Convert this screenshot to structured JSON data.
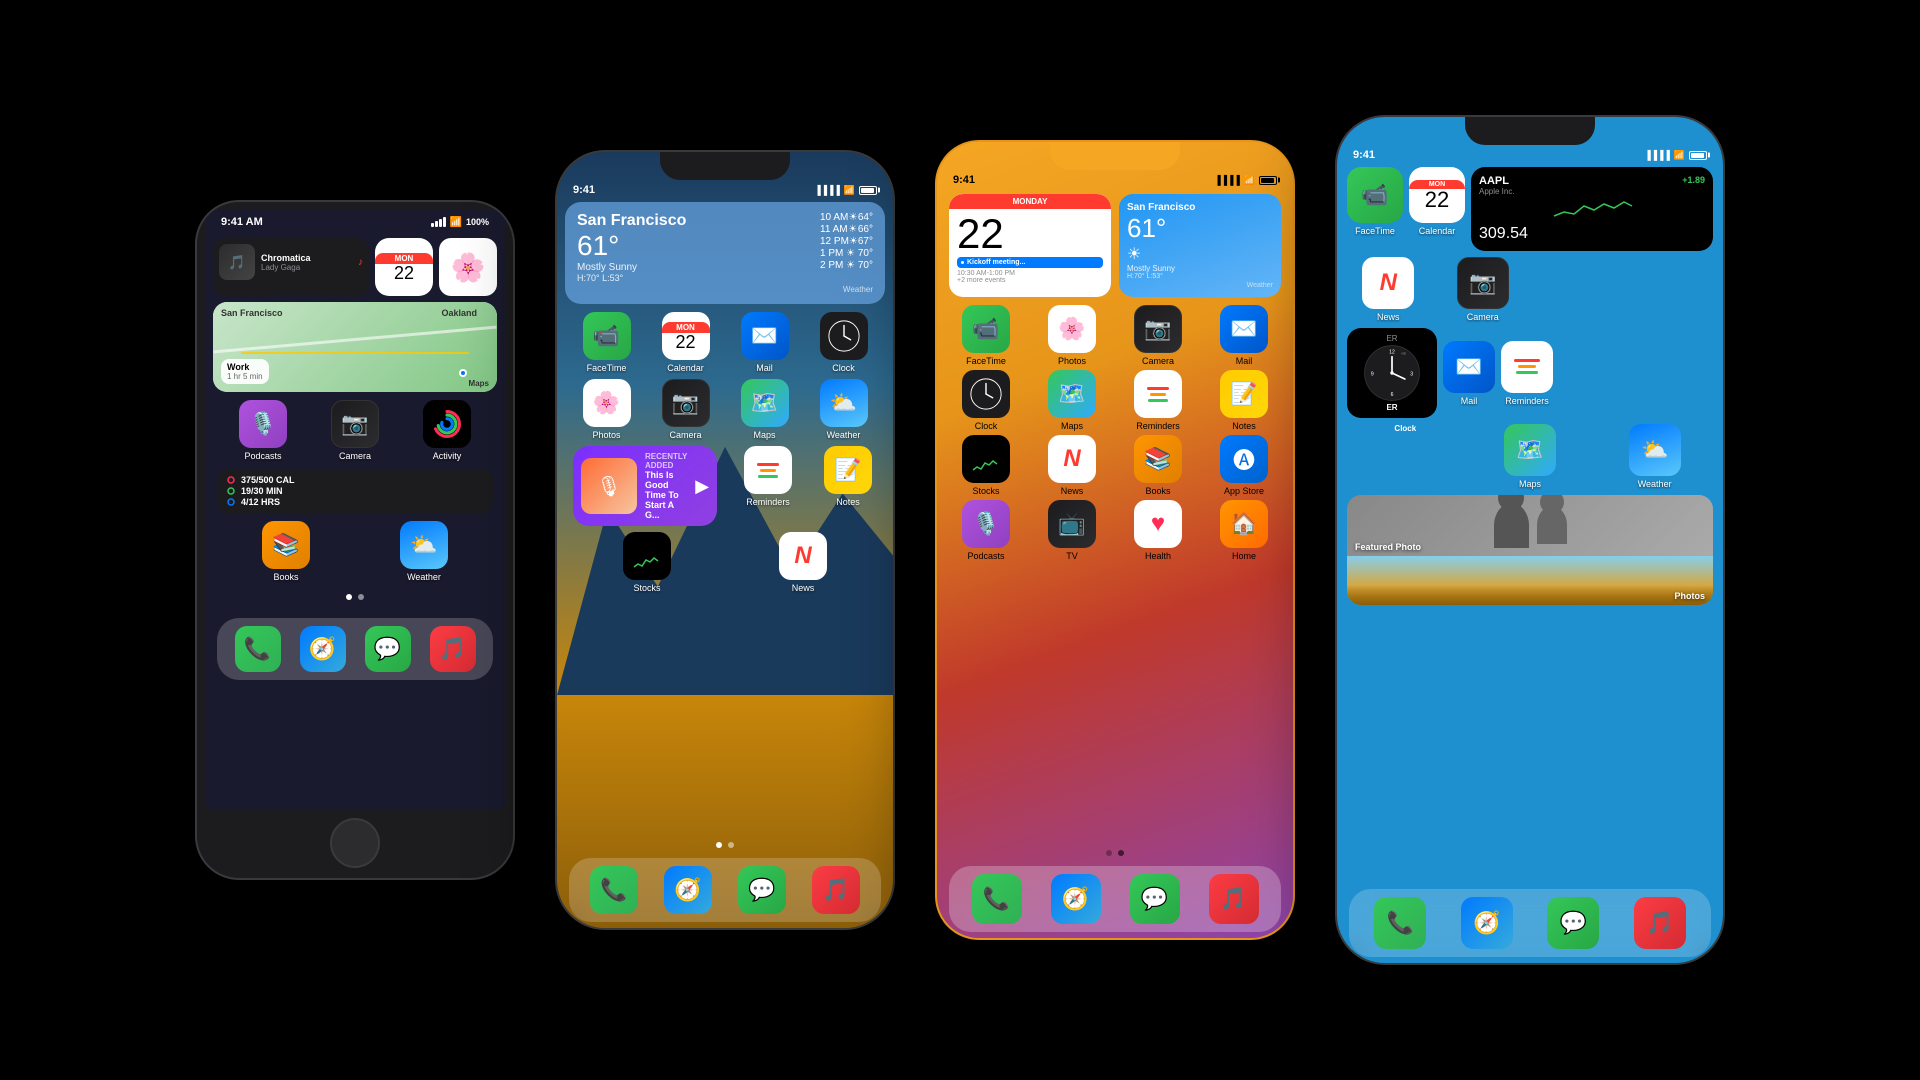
{
  "phones": {
    "se": {
      "status_time": "9:41 AM",
      "status_battery": "100%",
      "widgets": {
        "music": {
          "title": "Chromatica",
          "artist": "Lady Gaga"
        },
        "calendar": {
          "day": "22",
          "month": "MON"
        },
        "photos": {
          "label": "Photos"
        },
        "map": {
          "title": "San Francisco",
          "subtitle": "Oakland"
        },
        "work": {
          "label": "Work",
          "time": "1 hr 5 min"
        },
        "activity": {
          "label": "Activity",
          "cal": "375/500 CAL",
          "min": "19/30 MIN",
          "hrs": "4/12 HRS"
        }
      },
      "apps": {
        "row1": [
          "Podcasts",
          "Camera",
          "Activity"
        ],
        "row2": [
          "Books",
          "Weather"
        ],
        "dock": [
          "Phone",
          "Safari",
          "Messages",
          "Music"
        ]
      }
    },
    "xr": {
      "status_time": "9:41",
      "weather_city": "San Francisco",
      "weather_temp": "61°",
      "weather_condition": "Mostly Sunny",
      "weather_high": "H:70°",
      "weather_low": "L:53°",
      "weather_rows": [
        {
          "time": "10 AM",
          "icon": "☀",
          "temp": "64°"
        },
        {
          "time": "11 AM",
          "icon": "☀",
          "temp": "66°"
        },
        {
          "time": "12 PM",
          "icon": "☀",
          "temp": "67°"
        },
        {
          "time": "1 PM",
          "icon": "☀",
          "temp": "70°"
        },
        {
          "time": "2 PM",
          "icon": "☀",
          "temp": "70°"
        }
      ],
      "app_rows": [
        [
          "FaceTime",
          "Calendar",
          "Mail",
          "Clock"
        ],
        [
          "Photos",
          "Camera",
          "Maps",
          "Weather"
        ],
        [
          "Podcasts",
          "Stocks",
          "News"
        ],
        [
          "Reminders",
          "Notes"
        ]
      ],
      "podcast_title": "Recently Added",
      "podcast_subtitle": "This Is Good Time To Start A G...",
      "dock": [
        "Phone",
        "Safari",
        "Messages",
        "Music"
      ]
    },
    "phone12": {
      "status_time": "9:41",
      "cal_day": "22",
      "cal_dow": "MONDAY",
      "cal_event": "Kickoff meeting...",
      "cal_event_time": "10:30 AM-1:00 PM",
      "cal_more": "+2 more events",
      "weather_city": "San Francisco",
      "weather_temp": "61°",
      "weather_condition": "Mostly Sunny",
      "weather_hl": "H:70° L:53°",
      "app_rows": [
        [
          "FaceTime",
          "Photos",
          "Camera",
          "Mail"
        ],
        [
          "Clock",
          "Maps",
          "Reminders",
          "Notes"
        ],
        [
          "Stocks",
          "News",
          "Books",
          "App Store"
        ],
        [
          "Podcasts",
          "TV",
          "Health",
          "Home"
        ]
      ],
      "dock": [
        "Phone",
        "Safari",
        "Messages",
        "Music"
      ]
    },
    "phone12pro": {
      "status_time": "9:41",
      "facetime": "FaceTime",
      "calendar_day": "22",
      "calendar_dow": "MON",
      "stocks_ticker": "AAPL",
      "stocks_company": "Apple Inc.",
      "stocks_price": "309.54",
      "stocks_change": "+1.89",
      "news": "News",
      "camera": "Camera",
      "mail": "Mail",
      "reminders": "Reminders",
      "clock": "Clock",
      "maps": "Maps",
      "weather": "Weather",
      "featured_photo": "Featured Photo",
      "photos_label": "Photos",
      "dock": [
        "Phone",
        "Safari",
        "Messages",
        "Music"
      ]
    }
  },
  "colors": {
    "background": "#000000",
    "accent_blue": "#007aff",
    "accent_green": "#34c759",
    "accent_red": "#ff3b30",
    "accent_yellow": "#ffcc00",
    "accent_orange": "#ff9500",
    "accent_purple": "#af52de"
  }
}
